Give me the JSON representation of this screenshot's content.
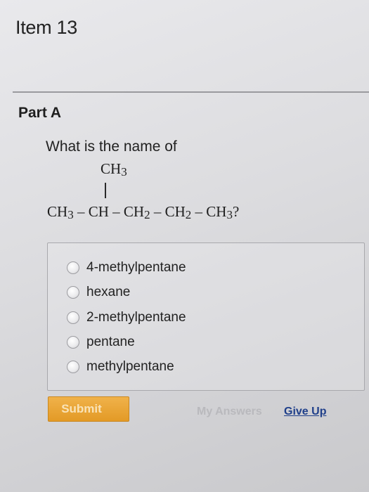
{
  "item": {
    "title": "Item 13"
  },
  "part": {
    "title": "Part A"
  },
  "question": {
    "prompt": "What is the name of",
    "branch": {
      "group": "CH",
      "sub": "3"
    },
    "bond": "|",
    "chain": [
      {
        "group": "CH",
        "sub": "3",
        "sep": " – "
      },
      {
        "group": "CH",
        "sub": "",
        "sep": " – "
      },
      {
        "group": "CH",
        "sub": "2",
        "sep": " – "
      },
      {
        "group": "CH",
        "sub": "2",
        "sep": " – "
      },
      {
        "group": "CH",
        "sub": "3",
        "sep": "?"
      }
    ]
  },
  "options": [
    {
      "label": "4-methylpentane",
      "selected": false
    },
    {
      "label": "hexane",
      "selected": false
    },
    {
      "label": "2-methylpentane",
      "selected": false
    },
    {
      "label": "pentane",
      "selected": false
    },
    {
      "label": "methylpentane",
      "selected": false
    }
  ],
  "actions": {
    "submit": "Submit",
    "my_answers": "My Answers",
    "give_up": "Give Up"
  },
  "colors": {
    "submit_bg": "#e8a535",
    "link": "#1f3f8a",
    "disabled_link": "#b9b9bd"
  }
}
